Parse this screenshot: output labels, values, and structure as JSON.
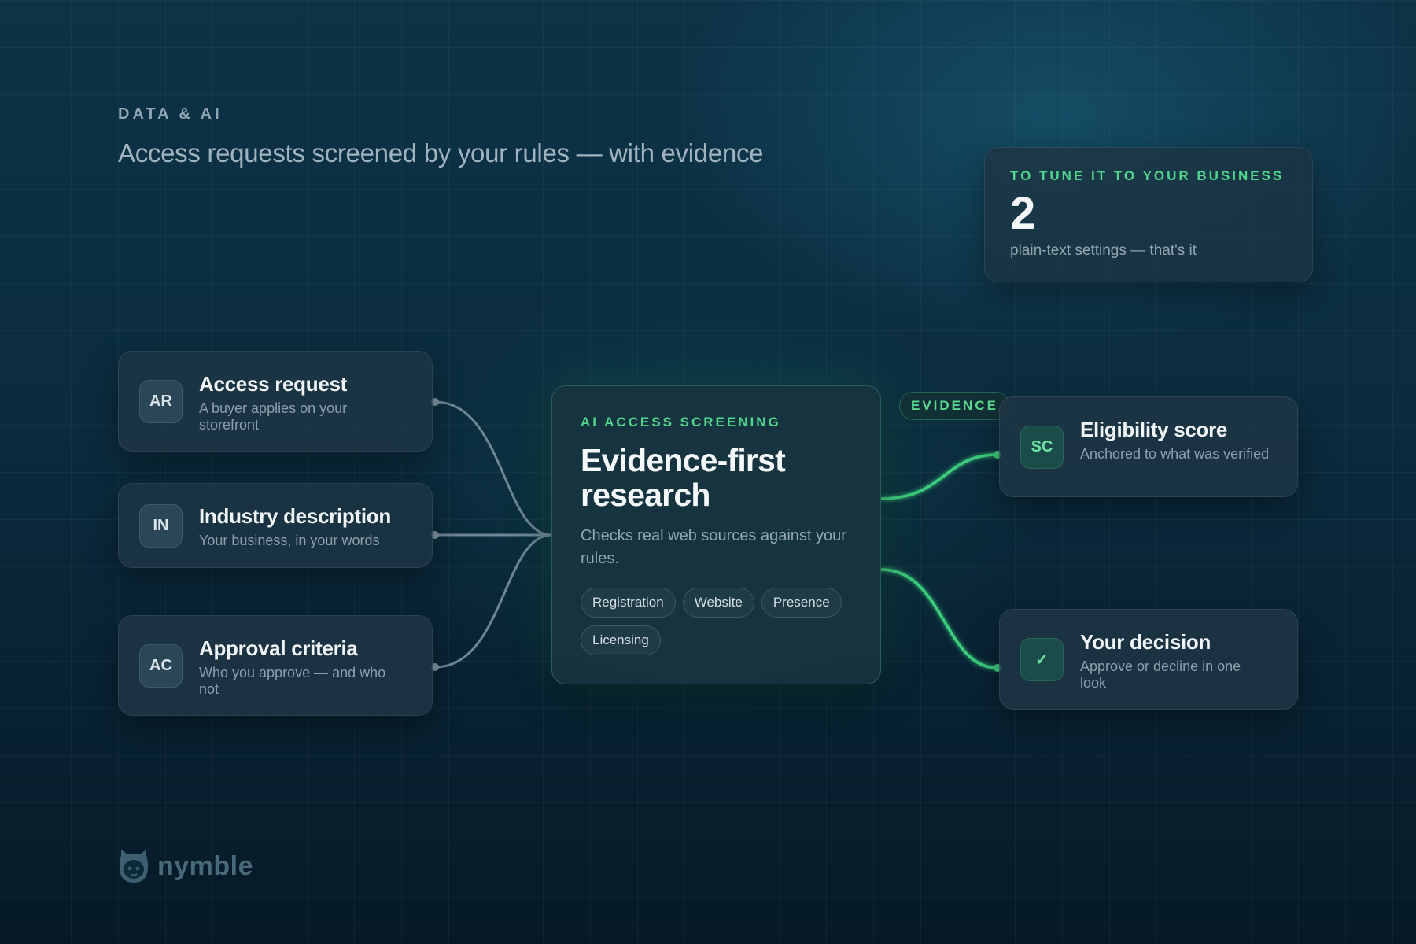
{
  "header": {
    "eyebrow": "DATA & AI",
    "headline": "Access requests screened by your rules — with evidence"
  },
  "stat": {
    "label": "TO TUNE IT TO YOUR BUSINESS",
    "value": "2",
    "caption": "plain-text settings — that's it"
  },
  "inputs": [
    {
      "badge": "AR",
      "title": "Access request",
      "subtitle": "A buyer applies on your storefront"
    },
    {
      "badge": "IN",
      "title": "Industry description",
      "subtitle": "Your business, in your words"
    },
    {
      "badge": "AC",
      "title": "Approval criteria",
      "subtitle": "Who you approve — and who not"
    }
  ],
  "center": {
    "kicker": "AI ACCESS SCREENING",
    "title": "Evidence-first research",
    "description": "Checks real web sources against your rules.",
    "chips": [
      "Registration",
      "Website",
      "Presence",
      "Licensing"
    ]
  },
  "evidence_label": "EVIDENCE",
  "outputs": [
    {
      "badge": "SC",
      "title": "Eligibility score",
      "subtitle": "Anchored to what was verified"
    },
    {
      "badge": "✓",
      "title": "Your decision",
      "subtitle": "Approve or decline in one look"
    }
  ],
  "brand": {
    "name": "nymble"
  },
  "colors": {
    "accent_green": "#4fd68c",
    "link_gray": "#6f8795",
    "background": "#0b2c3e"
  }
}
